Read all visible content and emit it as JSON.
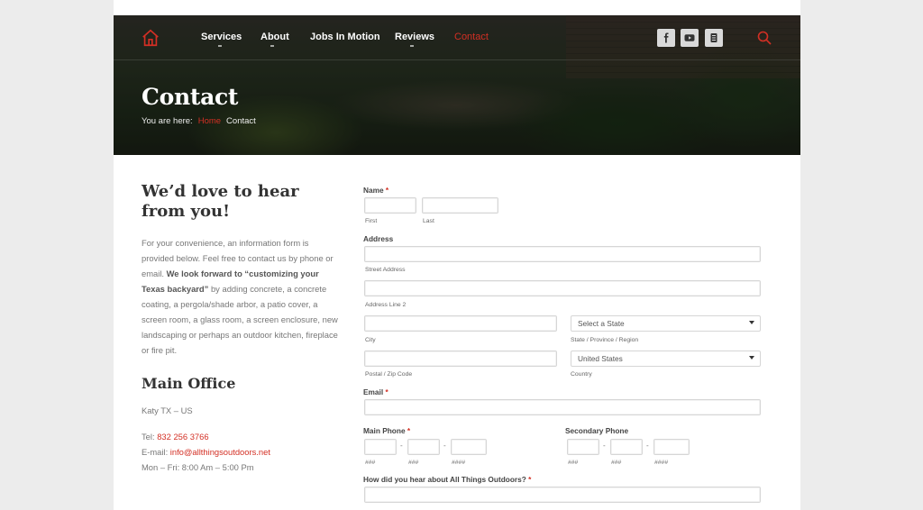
{
  "nav": {
    "items": [
      {
        "label": "Services",
        "caret": true
      },
      {
        "label": "About",
        "caret": true
      },
      {
        "label": "Jobs In Motion",
        "caret": false
      },
      {
        "label": "Reviews",
        "caret": true
      },
      {
        "label": "Contact",
        "caret": false,
        "active": true
      }
    ],
    "social_icons": [
      "facebook-icon",
      "youtube-icon",
      "blog-icon"
    ],
    "accent": "#d32f24"
  },
  "hero": {
    "title": "Contact",
    "breadcrumb_prefix": "You are here:",
    "breadcrumb_home": "Home",
    "breadcrumb_current": "Contact"
  },
  "left": {
    "heading": "We’d love to hear from you!",
    "intro_1": "For your convenience, an information form is provided below. Feel free to contact us by phone or email.",
    "intro_bold": "We look forward to “customizing your Texas backyard”",
    "intro_2": "by adding concrete, a concrete coating, a pergola/shade arbor, a patio cover, a screen room, a glass room, a screen enclosure, new landscaping or perhaps an outdoor kitchen, fireplace or fire pit.",
    "office_heading": "Main Office",
    "location": "Katy TX – US",
    "tel_label": "Tel:",
    "tel": "832 256 3766",
    "email_label": "E-mail:",
    "email": "info@allthingsoutdoors.net",
    "hours": "Mon – Fri: 8:00 Am – 5:00 Pm"
  },
  "form": {
    "name_label": "Name",
    "required_mark": "*",
    "first_label": "First",
    "last_label": "Last",
    "address_label": "Address",
    "street_label": "Street Address",
    "line2_label": "Address Line 2",
    "city_label": "City",
    "state_select": "Select a State",
    "state_label": "State / Province / Region",
    "zip_label": "Postal / Zip Code",
    "country_select": "United States",
    "country_label": "Country",
    "email_label": "Email",
    "main_phone_label": "Main Phone",
    "secondary_phone_label": "Secondary Phone",
    "phone_area_hint": "###",
    "phone_prefix_hint": "###",
    "phone_line_hint": "####",
    "dash": "-",
    "hear_label": "How did you hear about All Things Outdoors?"
  }
}
